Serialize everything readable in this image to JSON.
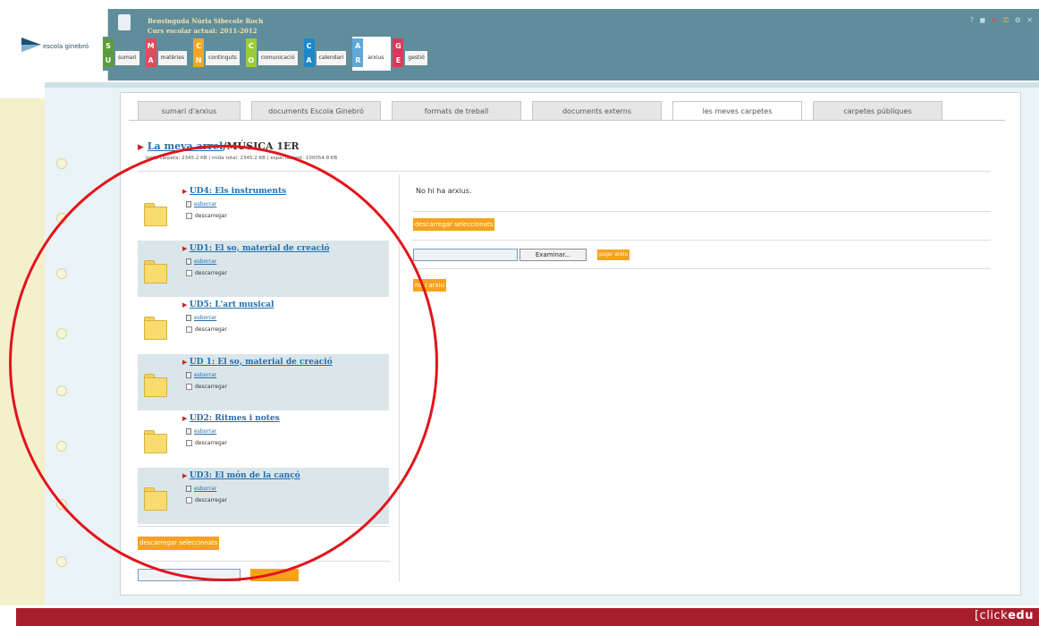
{
  "header": {
    "logo_text": "escola ginebró",
    "welcome": "Benvinguda Núria Sibecole Roch",
    "school_year": "Curs escolar actual: 2011-2012",
    "top_icons": [
      "help-icon",
      "print-icon",
      "mail-icon",
      "key-icon",
      "settings-icon",
      "close-icon"
    ]
  },
  "modules": [
    {
      "letters": [
        "S",
        "U"
      ],
      "label": "sumari",
      "color": "#5b9b3b"
    },
    {
      "letters": [
        "M",
        "A"
      ],
      "label": "matèries",
      "color": "#e5495b"
    },
    {
      "letters": [
        "C",
        "N"
      ],
      "label": "continguts",
      "color": "#f6a623"
    },
    {
      "letters": [
        "C",
        "O"
      ],
      "label": "comunicació",
      "color": "#9ccb3b"
    },
    {
      "letters": [
        "C",
        "A"
      ],
      "label": "calendari",
      "color": "#1e88c8"
    },
    {
      "letters": [
        "A",
        "R"
      ],
      "label": "arxius",
      "color": "#5fa8d8"
    },
    {
      "letters": [
        "G",
        "E"
      ],
      "label": "gestió",
      "color": "#d93a5a"
    }
  ],
  "subtabs": [
    "sumari d'arxius",
    "documents Escola Ginebró",
    "formats de treball",
    "documents externs",
    "les meves carpetes",
    "carpetes públiques"
  ],
  "breadcrumb": {
    "root": "La meva arrel",
    "current": "/MÚSICA 1ER"
  },
  "stats": "mida carpeta: 2345.2 KB | mida total: 2345.2 KB | espai restant: 100054.8 KB",
  "folders": [
    {
      "title": "UD4: Els instruments",
      "delete_label": "esborrar",
      "download_label": "descarregar"
    },
    {
      "title": "UD1: El so, material de creació",
      "delete_label": "esborrar",
      "download_label": "descarregar"
    },
    {
      "title": "UD5: L'art musical",
      "delete_label": "esborrar",
      "download_label": "descarregar"
    },
    {
      "title": "UD 1: El so, material de creació",
      "delete_label": "esborrar",
      "download_label": "descarregar"
    },
    {
      "title": "UD2: Ritmes i notes",
      "delete_label": "esborrar",
      "download_label": "descarregar"
    },
    {
      "title": "UD3: El món de la cançó",
      "delete_label": "esborrar",
      "download_label": "descarregar"
    }
  ],
  "left_actions": {
    "download_selected": "descarregar seleccionats"
  },
  "right": {
    "no_files": "No hi ha arxius.",
    "download_selected": "descarregar seleccionats",
    "browse": "Examinar...",
    "upload": "pujar arxiu",
    "new_file": "nou arxiu"
  },
  "footer": {
    "brand_prefix": "[click",
    "brand_suffix": "edu"
  },
  "colors": {
    "accent_orange": "#f7a21b",
    "link_blue": "#1f6fb2",
    "header_teal": "#5f8d9c",
    "footer_red": "#a81d2c",
    "annotation_red": "#e1141c"
  }
}
